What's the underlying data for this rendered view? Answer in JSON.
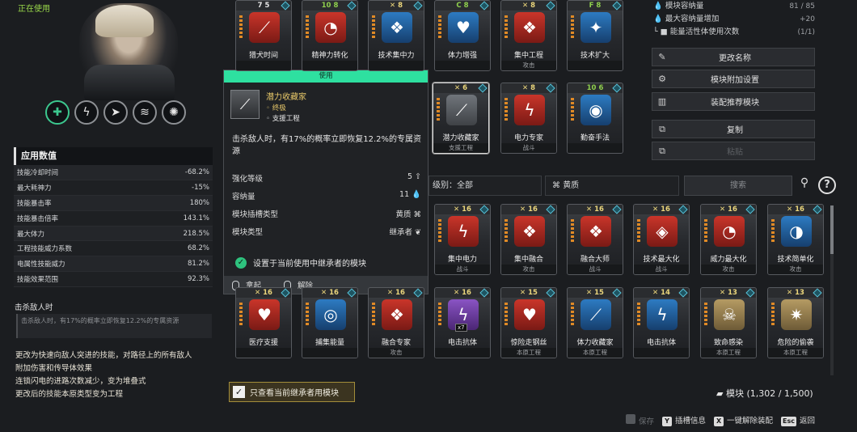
{
  "status": "正在使用",
  "skills": [
    {
      "icon": "heal-drone-icon",
      "glyph": "✚",
      "active": true
    },
    {
      "icon": "lightning-burst-icon",
      "glyph": "ϟ",
      "active": false
    },
    {
      "icon": "chain-lightning-icon",
      "glyph": "➤",
      "active": false
    },
    {
      "icon": "thunder-claw-icon",
      "glyph": "≋",
      "active": false
    },
    {
      "icon": "storm-orb-icon",
      "glyph": "✺",
      "active": false
    }
  ],
  "stats": {
    "title": "应用数值",
    "rows": [
      {
        "name": "技能冷却时间",
        "value": "-68.2%"
      },
      {
        "name": "最大耗神力",
        "value": "-15%"
      },
      {
        "name": "技能暴击率",
        "value": "180%"
      },
      {
        "name": "技能暴击倍率",
        "value": "143.1%"
      },
      {
        "name": "最大体力",
        "value": "218.5%"
      },
      {
        "name": "工程技能威力系数",
        "value": "68.2%"
      },
      {
        "name": "电属性技能威力",
        "value": "81.2%"
      },
      {
        "name": "技能效果范围",
        "value": "92.3%"
      }
    ]
  },
  "kill_section": {
    "title": "击杀敌人时",
    "desc": "击杀敌人时，有17%的概率立即恢复12.2%的专属资源"
  },
  "effect_lines": [
    "更改为快速向敌人突进的技能，对路径上的所有敌人",
    "附加伤害和传导体效果",
    "连锁闪电的进路次数减少，变为堆叠式",
    "更改后的技能本原类型变为工程"
  ],
  "capacity": {
    "line1": "模块容纳量",
    "line1_val": "81 / 85",
    "line2": "最大容纳量增加",
    "line2_val": "+20",
    "line3": "能量活性体使用次数",
    "line3_val": "(1/1)"
  },
  "menu": {
    "rename": "更改名称",
    "add_slot": "模块附加设置",
    "recommend": "装配推荐模块",
    "copy": "复制",
    "paste": "粘贴"
  },
  "equipped_modules": [
    {
      "cap": "7",
      "badge": "5",
      "label": "猎犬时间",
      "sub": "",
      "color": "red",
      "glyph": "⟋"
    },
    {
      "cap": "10",
      "badge": "8",
      "label": "精神力转化",
      "sub": "",
      "color": "red",
      "glyph": "◔"
    },
    {
      "cap": "X",
      "badge": "8",
      "label": "技术集中力",
      "sub": "",
      "color": "blue",
      "glyph": "❖"
    },
    {
      "cap": "C",
      "badge": "8",
      "label": "体力增强",
      "sub": "",
      "color": "blue",
      "glyph": "♥"
    },
    {
      "cap": "X",
      "badge": "8",
      "label": "集中工程",
      "sub": "攻击",
      "color": "red",
      "glyph": "❖"
    },
    {
      "cap": "F",
      "badge": "8",
      "label": "技术扩大",
      "sub": "",
      "color": "blue",
      "glyph": "✦"
    },
    {
      "cap": "X",
      "badge": "6",
      "label": "潜力收藏家",
      "sub": "支援工程",
      "color": "grey",
      "glyph": "⟋"
    },
    {
      "cap": "X",
      "badge": "8",
      "label": "电力专家",
      "sub": "战斗",
      "color": "red",
      "glyph": "ϟ"
    },
    {
      "cap": "10",
      "badge": "6",
      "label": "勤奋手法",
      "sub": "",
      "color": "blue",
      "glyph": "◉"
    }
  ],
  "tooltip": {
    "header": "使用",
    "name": "潜力收藏家",
    "tier": "终极",
    "class": "支援工程",
    "desc": "击杀敌人时，有17%的概率立即恢复12.2%的专属资源",
    "enhance_label": "强化等级",
    "enhance_value": "5",
    "capacity_label": "容纳量",
    "capacity_value": "11",
    "socket_label": "模块插槽类型",
    "socket_value": "黄质",
    "type_label": "模块类型",
    "type_value": "继承者",
    "check_text": "设置于当前使用中继承者的模块",
    "action1": "拿起",
    "action2": "解除"
  },
  "filters": {
    "tier": "级别：全部",
    "type": "黄质",
    "search_placeholder": "搜索"
  },
  "inventory": [
    {
      "cap": "X",
      "badge": "16",
      "label": "集中电力",
      "sub": "战斗",
      "color": "red",
      "glyph": "ϟ"
    },
    {
      "cap": "X",
      "badge": "16",
      "label": "集中融合",
      "sub": "攻击",
      "color": "red",
      "glyph": "❖"
    },
    {
      "cap": "X",
      "badge": "16",
      "label": "融合大师",
      "sub": "战斗",
      "color": "red",
      "glyph": "❖"
    },
    {
      "cap": "X",
      "badge": "16",
      "label": "技术最大化",
      "sub": "战斗",
      "color": "red",
      "glyph": "◈"
    },
    {
      "cap": "X",
      "badge": "16",
      "label": "威力最大化",
      "sub": "攻击",
      "color": "red",
      "glyph": "◔"
    },
    {
      "cap": "X",
      "badge": "16",
      "label": "技术简单化",
      "sub": "攻击",
      "color": "blue",
      "glyph": "◑"
    },
    {
      "cap": "X",
      "badge": "16",
      "label": "医疗支援",
      "sub": "",
      "color": "red",
      "glyph": "♥"
    },
    {
      "cap": "X",
      "badge": "16",
      "label": "捕集能量",
      "sub": "",
      "color": "blue",
      "glyph": "◎"
    },
    {
      "cap": "X",
      "badge": "16",
      "label": "融合专家",
      "sub": "攻击",
      "color": "red",
      "glyph": "❖"
    },
    {
      "cap": "X",
      "badge": "16",
      "label": "电击抗体",
      "sub": "",
      "color": "purple",
      "glyph": "ϟ"
    },
    {
      "cap": "X",
      "badge": "15",
      "label": "惊险走钢丝",
      "sub": "本原工程",
      "color": "red",
      "glyph": "♥"
    },
    {
      "cap": "X",
      "badge": "15",
      "label": "体力收藏家",
      "sub": "本原工程",
      "color": "blue",
      "glyph": "⟋"
    },
    {
      "cap": "X",
      "badge": "14",
      "label": "电击抗体",
      "sub": "",
      "color": "blue",
      "glyph": "ϟ"
    },
    {
      "cap": "X",
      "badge": "13",
      "label": "致命感染",
      "sub": "本原工程",
      "color": "gold",
      "glyph": "☠"
    },
    {
      "cap": "X",
      "badge": "13",
      "label": "危险的偷袭",
      "sub": "本原工程",
      "color": "gold",
      "glyph": "✷"
    }
  ],
  "inventory_counter": "x7",
  "only_current": "只查看当前继承者用模块",
  "module_count": "模块 (1,302 / 1,500)",
  "footer": {
    "save": "保存",
    "info_key": "Y",
    "info": "插槽信息",
    "unequip_key": "X",
    "unequip": "一键解除装配",
    "back_key": "Esc",
    "back": "返回"
  }
}
